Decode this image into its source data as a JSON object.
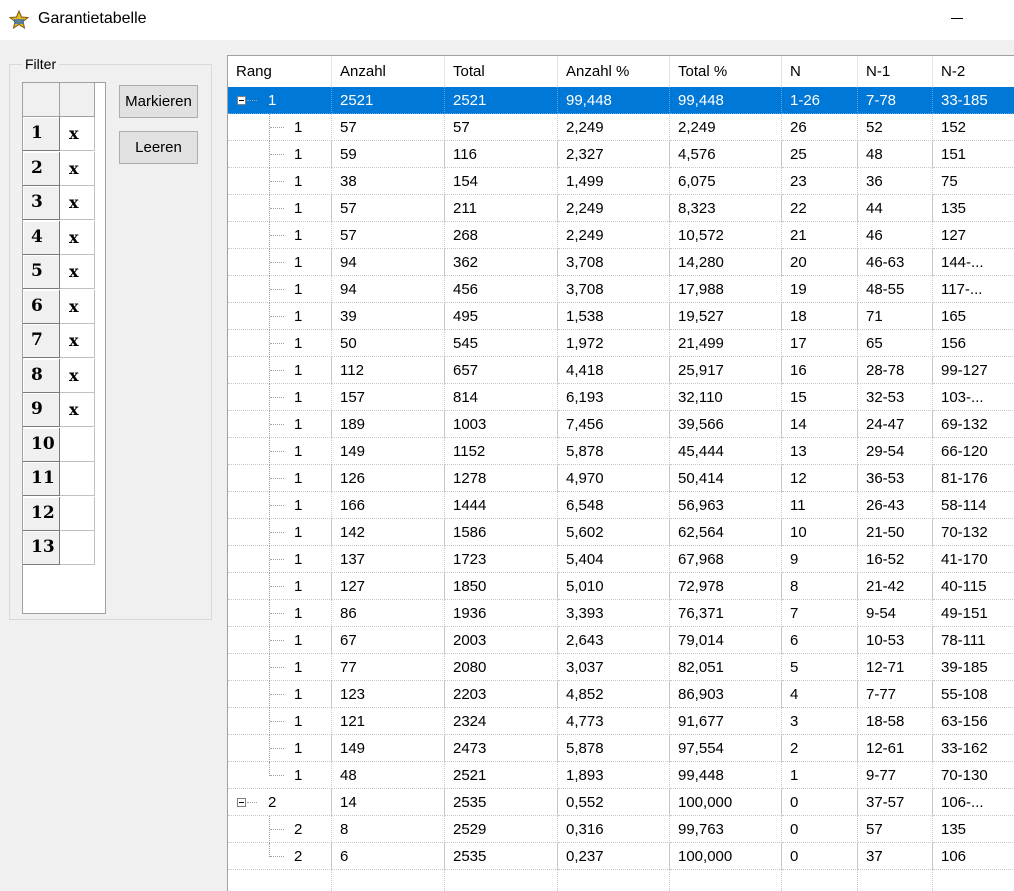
{
  "window": {
    "title": "Garantietabelle"
  },
  "filter": {
    "legend": "Filter",
    "rows": [
      {
        "num": "1",
        "val": "x"
      },
      {
        "num": "2",
        "val": "x"
      },
      {
        "num": "3",
        "val": "x"
      },
      {
        "num": "4",
        "val": "x"
      },
      {
        "num": "5",
        "val": "x"
      },
      {
        "num": "6",
        "val": "x"
      },
      {
        "num": "7",
        "val": "x"
      },
      {
        "num": "8",
        "val": "x"
      },
      {
        "num": "9",
        "val": "x"
      },
      {
        "num": "10",
        "val": ""
      },
      {
        "num": "11",
        "val": ""
      },
      {
        "num": "12",
        "val": ""
      },
      {
        "num": "13",
        "val": ""
      }
    ],
    "mark_label": "Markieren",
    "clear_label": "Leeren"
  },
  "table": {
    "columns": [
      "Rang",
      "Anzahl",
      "Total",
      "Anzahl %",
      "Total %",
      "N",
      "N-1",
      "N-2"
    ],
    "rows": [
      {
        "level": 0,
        "group": true,
        "selected": true,
        "cells": [
          "1",
          "2521",
          "2521",
          "99,448",
          "99,448",
          "1-26",
          "7-78",
          "33-185"
        ]
      },
      {
        "level": 1,
        "cells": [
          "1",
          "57",
          "57",
          "2,249",
          "2,249",
          "26",
          "52",
          "152"
        ]
      },
      {
        "level": 1,
        "cells": [
          "1",
          "59",
          "116",
          "2,327",
          "4,576",
          "25",
          "48",
          "151"
        ]
      },
      {
        "level": 1,
        "cells": [
          "1",
          "38",
          "154",
          "1,499",
          "6,075",
          "23",
          "36",
          "75"
        ]
      },
      {
        "level": 1,
        "cells": [
          "1",
          "57",
          "211",
          "2,249",
          "8,323",
          "22",
          "44",
          "135"
        ]
      },
      {
        "level": 1,
        "cells": [
          "1",
          "57",
          "268",
          "2,249",
          "10,572",
          "21",
          "46",
          "127"
        ]
      },
      {
        "level": 1,
        "cells": [
          "1",
          "94",
          "362",
          "3,708",
          "14,280",
          "20",
          "46-63",
          "144-..."
        ]
      },
      {
        "level": 1,
        "cells": [
          "1",
          "94",
          "456",
          "3,708",
          "17,988",
          "19",
          "48-55",
          "117-..."
        ]
      },
      {
        "level": 1,
        "cells": [
          "1",
          "39",
          "495",
          "1,538",
          "19,527",
          "18",
          "71",
          "165"
        ]
      },
      {
        "level": 1,
        "cells": [
          "1",
          "50",
          "545",
          "1,972",
          "21,499",
          "17",
          "65",
          "156"
        ]
      },
      {
        "level": 1,
        "cells": [
          "1",
          "112",
          "657",
          "4,418",
          "25,917",
          "16",
          "28-78",
          "99-127"
        ]
      },
      {
        "level": 1,
        "cells": [
          "1",
          "157",
          "814",
          "6,193",
          "32,110",
          "15",
          "32-53",
          "103-..."
        ]
      },
      {
        "level": 1,
        "cells": [
          "1",
          "189",
          "1003",
          "7,456",
          "39,566",
          "14",
          "24-47",
          "69-132"
        ]
      },
      {
        "level": 1,
        "cells": [
          "1",
          "149",
          "1152",
          "5,878",
          "45,444",
          "13",
          "29-54",
          "66-120"
        ]
      },
      {
        "level": 1,
        "cells": [
          "1",
          "126",
          "1278",
          "4,970",
          "50,414",
          "12",
          "36-53",
          "81-176"
        ]
      },
      {
        "level": 1,
        "cells": [
          "1",
          "166",
          "1444",
          "6,548",
          "56,963",
          "11",
          "26-43",
          "58-114"
        ]
      },
      {
        "level": 1,
        "cells": [
          "1",
          "142",
          "1586",
          "5,602",
          "62,564",
          "10",
          "21-50",
          "70-132"
        ]
      },
      {
        "level": 1,
        "cells": [
          "1",
          "137",
          "1723",
          "5,404",
          "67,968",
          "9",
          "16-52",
          "41-170"
        ]
      },
      {
        "level": 1,
        "cells": [
          "1",
          "127",
          "1850",
          "5,010",
          "72,978",
          "8",
          "21-42",
          "40-115"
        ]
      },
      {
        "level": 1,
        "cells": [
          "1",
          "86",
          "1936",
          "3,393",
          "76,371",
          "7",
          "9-54",
          "49-151"
        ]
      },
      {
        "level": 1,
        "cells": [
          "1",
          "67",
          "2003",
          "2,643",
          "79,014",
          "6",
          "10-53",
          "78-111"
        ]
      },
      {
        "level": 1,
        "cells": [
          "1",
          "77",
          "2080",
          "3,037",
          "82,051",
          "5",
          "12-71",
          "39-185"
        ]
      },
      {
        "level": 1,
        "cells": [
          "1",
          "123",
          "2203",
          "4,852",
          "86,903",
          "4",
          "7-77",
          "55-108"
        ]
      },
      {
        "level": 1,
        "cells": [
          "1",
          "121",
          "2324",
          "4,773",
          "91,677",
          "3",
          "18-58",
          "63-156"
        ]
      },
      {
        "level": 1,
        "cells": [
          "1",
          "149",
          "2473",
          "5,878",
          "97,554",
          "2",
          "12-61",
          "33-162"
        ]
      },
      {
        "level": 1,
        "last": true,
        "cells": [
          "1",
          "48",
          "2521",
          "1,893",
          "99,448",
          "1",
          "9-77",
          "70-130"
        ]
      },
      {
        "level": 0,
        "group": true,
        "cells": [
          "2",
          "14",
          "2535",
          "0,552",
          "100,000",
          "0",
          "37-57",
          "106-..."
        ]
      },
      {
        "level": 1,
        "cells": [
          "2",
          "8",
          "2529",
          "0,316",
          "99,763",
          "0",
          "57",
          "135"
        ]
      },
      {
        "level": 1,
        "last": true,
        "cells": [
          "2",
          "6",
          "2535",
          "0,237",
          "100,000",
          "0",
          "37",
          "106"
        ]
      }
    ]
  },
  "colors": {
    "selection": "#0078d7"
  }
}
